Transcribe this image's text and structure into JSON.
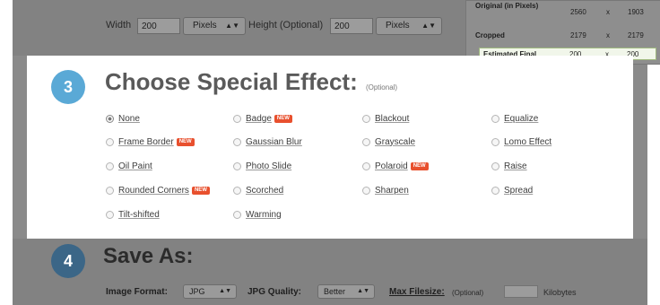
{
  "resize": {
    "width_label": "Width",
    "width_value": "200",
    "width_unit": "Pixels",
    "height_label": "Height (Optional)",
    "height_value": "200",
    "height_unit": "Pixels"
  },
  "stats": {
    "original_label": "Original (in Pixels)",
    "original_w": "2560",
    "original_x": "x",
    "original_h": "1903",
    "cropped_label": "Cropped",
    "cropped_w": "2179",
    "cropped_x": "x",
    "cropped_h": "2179",
    "final_label": "Estimated Final",
    "final_w": "200",
    "final_x": "x",
    "final_h": "200"
  },
  "effects_section": {
    "step": "3",
    "title": "Choose Special Effect:",
    "optional": "(Optional)",
    "new_badge": "NEW",
    "effects": [
      {
        "label": "None",
        "selected": true,
        "new": false
      },
      {
        "label": "Badge",
        "selected": false,
        "new": true
      },
      {
        "label": "Blackout",
        "selected": false,
        "new": false
      },
      {
        "label": "Equalize",
        "selected": false,
        "new": false
      },
      {
        "label": "Frame Border",
        "selected": false,
        "new": true
      },
      {
        "label": "Gaussian Blur",
        "selected": false,
        "new": false
      },
      {
        "label": "Grayscale",
        "selected": false,
        "new": false
      },
      {
        "label": "Lomo Effect",
        "selected": false,
        "new": false
      },
      {
        "label": "Oil Paint",
        "selected": false,
        "new": false
      },
      {
        "label": "Photo Slide",
        "selected": false,
        "new": false
      },
      {
        "label": "Polaroid",
        "selected": false,
        "new": true
      },
      {
        "label": "Raise",
        "selected": false,
        "new": false
      },
      {
        "label": "Rounded Corners",
        "selected": false,
        "new": true
      },
      {
        "label": "Scorched",
        "selected": false,
        "new": false
      },
      {
        "label": "Sharpen",
        "selected": false,
        "new": false
      },
      {
        "label": "Spread",
        "selected": false,
        "new": false
      },
      {
        "label": "Tilt-shifted",
        "selected": false,
        "new": false
      },
      {
        "label": "Warming",
        "selected": false,
        "new": false
      }
    ]
  },
  "save_section": {
    "step": "4",
    "title": "Save As:",
    "format_label": "Image Format:",
    "format_value": "JPG",
    "quality_label": "JPG Quality:",
    "quality_value": "Better",
    "max_size_label": "Max Filesize:",
    "max_size_optional": "(Optional)",
    "max_size_unit": "Kilobytes"
  },
  "colors": {
    "step3_circle": "#5aa9d6",
    "step4_circle": "#3b6687",
    "new_badge": "#e8502e"
  }
}
